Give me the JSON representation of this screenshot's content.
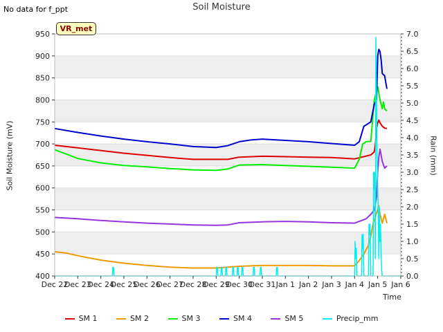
{
  "corner_note": "No data for f_ppt",
  "station_badge": "VR_met",
  "chart_data": {
    "type": "line",
    "title": "Soil Moisture",
    "xlabel": "Time",
    "ylabel": "Soil Moisture (mV)",
    "y2label": "Rain (mm)",
    "xlim": [
      0,
      15
    ],
    "ylim": [
      400,
      950
    ],
    "y2lim": [
      0,
      7.0
    ],
    "x_ticks": [
      0,
      1,
      2,
      3,
      4,
      5,
      6,
      7,
      8,
      9,
      10,
      11,
      12,
      13,
      14,
      15
    ],
    "x_tick_labels": [
      "Dec 22",
      "Dec 23",
      "Dec 24",
      "Dec 25",
      "Dec 26",
      "Dec 27",
      "Dec 28",
      "Dec 29",
      "Dec 30",
      "Dec 31",
      "Jan 1",
      "Jan 2",
      "Jan 3",
      "Jan 4",
      "Jan 5",
      "Jan 6"
    ],
    "y_ticks": [
      400,
      450,
      500,
      550,
      600,
      650,
      700,
      750,
      800,
      850,
      900,
      950
    ],
    "y2_ticks": [
      "0.0",
      "0.5",
      "1.0",
      "1.5",
      "2.0",
      "2.5",
      "3.0",
      "3.5",
      "4.0",
      "4.5",
      "5.0",
      "5.5",
      "6.0",
      "6.5",
      "7.0"
    ],
    "grid": true,
    "legend_position": "bottom",
    "series": [
      {
        "name": "SM 1",
        "color": "#dd0000",
        "axis": "left",
        "x": [
          0,
          1,
          2,
          3,
          4,
          5,
          6,
          7,
          7.5,
          8,
          9,
          10,
          11,
          12,
          13,
          13.7,
          13.85,
          13.9,
          13.95,
          14.0,
          14.05,
          14.1,
          14.2,
          14.3,
          14.4
        ],
        "y": [
          697,
          691,
          685,
          679,
          674,
          669,
          665,
          665,
          665,
          670,
          672,
          671,
          670,
          669,
          666,
          675,
          682,
          700,
          735,
          748,
          754,
          748,
          740,
          736,
          735
        ]
      },
      {
        "name": "SM 2",
        "color": "#ee9900",
        "axis": "left",
        "x": [
          0,
          0.5,
          1,
          2,
          3,
          4,
          5,
          6,
          7,
          7.5,
          8,
          9,
          10,
          11,
          12,
          13,
          13.2,
          13.4,
          13.6,
          13.7,
          13.8,
          13.9,
          14.0,
          14.05,
          14.1,
          14.2,
          14.3,
          14.4
        ],
        "y": [
          455,
          452,
          446,
          436,
          429,
          424,
          420,
          418,
          418,
          420,
          422,
          424,
          424,
          424,
          423,
          423,
          435,
          450,
          470,
          490,
          520,
          535,
          550,
          560,
          540,
          520,
          540,
          520
        ]
      },
      {
        "name": "SM 3",
        "color": "#00ee00",
        "axis": "left",
        "x": [
          0,
          0.5,
          1,
          2,
          3,
          4,
          5,
          6,
          7,
          7.5,
          8,
          9,
          10,
          11,
          12,
          13,
          13.2,
          13.35,
          13.5,
          13.7,
          13.85,
          13.9,
          14.0,
          14.05,
          14.1,
          14.2,
          14.25,
          14.3,
          14.4
        ],
        "y": [
          687,
          677,
          667,
          657,
          651,
          648,
          644,
          641,
          640,
          643,
          652,
          653,
          651,
          649,
          647,
          645,
          665,
          700,
          705,
          706,
          800,
          810,
          830,
          815,
          800,
          780,
          795,
          780,
          775
        ]
      },
      {
        "name": "SM 4",
        "color": "#0000cc",
        "axis": "left",
        "x": [
          0,
          1,
          2,
          3,
          4,
          5,
          6,
          7,
          7.5,
          8,
          8.5,
          9,
          10,
          11,
          12,
          13,
          13.2,
          13.4,
          13.7,
          13.85,
          13.95,
          14.0,
          14.05,
          14.1,
          14.15,
          14.2,
          14.3,
          14.35,
          14.4
        ],
        "y": [
          735,
          726,
          718,
          711,
          705,
          700,
          694,
          692,
          696,
          705,
          709,
          711,
          708,
          705,
          701,
          697,
          705,
          740,
          750,
          790,
          800,
          900,
          915,
          910,
          890,
          860,
          855,
          840,
          825
        ]
      },
      {
        "name": "SM 5",
        "color": "#9933dd",
        "axis": "left",
        "x": [
          0,
          1,
          2,
          3,
          4,
          5,
          6,
          7,
          7.5,
          8,
          9,
          10,
          11,
          12,
          13,
          13.2,
          13.5,
          13.7,
          13.85,
          13.95,
          14.0,
          14.05,
          14.1,
          14.2,
          14.3,
          14.4
        ],
        "y": [
          533,
          530,
          526,
          523,
          520,
          518,
          516,
          515,
          516,
          521,
          523,
          524,
          523,
          521,
          520,
          524,
          530,
          540,
          550,
          580,
          640,
          670,
          688,
          660,
          645,
          650
        ]
      },
      {
        "name": "Precip_mm",
        "color": "#00eeee",
        "axis": "right",
        "x": [
          0,
          2.5,
          2.52,
          2.55,
          2.57,
          2.6,
          7.0,
          7.02,
          7.05,
          7.07,
          7.1,
          7.2,
          7.22,
          7.25,
          7.27,
          7.3,
          7.4,
          7.42,
          7.45,
          7.47,
          7.5,
          7.7,
          7.72,
          7.75,
          7.77,
          7.8,
          7.9,
          7.92,
          7.95,
          7.97,
          8.0,
          8.1,
          8.12,
          8.15,
          8.17,
          8.2,
          8.6,
          8.62,
          8.65,
          8.67,
          8.7,
          8.9,
          8.92,
          8.95,
          8.97,
          9.0,
          9.6,
          9.62,
          9.65,
          9.67,
          9.7,
          10.0,
          12.8,
          13.0,
          13.02,
          13.05,
          13.07,
          13.1,
          13.3,
          13.32,
          13.35,
          13.37,
          13.4,
          13.6,
          13.62,
          13.65,
          13.67,
          13.7,
          13.8,
          13.82,
          13.85,
          13.87,
          13.9,
          13.92,
          13.95,
          13.97,
          14.0,
          14.02,
          14.05,
          14.07,
          14.1,
          14.12,
          14.15,
          14.17,
          14.2,
          14.5,
          15.0
        ],
        "y": [
          0,
          0,
          0.25,
          0.25,
          0,
          0,
          0,
          0.25,
          0.25,
          0,
          0,
          0,
          0.25,
          0.25,
          0,
          0,
          0,
          0.25,
          0.25,
          0,
          0,
          0,
          0.25,
          0.25,
          0,
          0,
          0,
          0.25,
          0.25,
          0,
          0,
          0,
          0.25,
          0.25,
          0,
          0,
          0,
          0.25,
          0.25,
          0,
          0,
          0,
          0.25,
          0.25,
          0,
          0,
          0,
          0.25,
          0.25,
          0,
          0,
          0,
          0,
          0,
          1.0,
          0.5,
          0.8,
          0,
          0,
          1.2,
          0.8,
          1.2,
          0,
          0,
          1.5,
          1.2,
          1.5,
          0,
          0,
          3.0,
          2.5,
          3.0,
          0.5,
          6.9,
          5.0,
          3.5,
          2.5,
          2.0,
          0.5,
          2.0,
          1.0,
          1.5,
          0.5,
          0.2,
          0,
          0,
          0
        ]
      }
    ]
  }
}
